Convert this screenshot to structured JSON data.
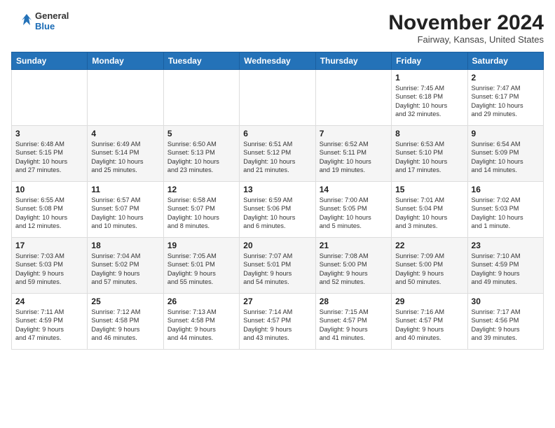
{
  "header": {
    "logo_line1": "General",
    "logo_line2": "Blue",
    "month": "November 2024",
    "location": "Fairway, Kansas, United States"
  },
  "days_of_week": [
    "Sunday",
    "Monday",
    "Tuesday",
    "Wednesday",
    "Thursday",
    "Friday",
    "Saturday"
  ],
  "weeks": [
    [
      {
        "day": "",
        "info": ""
      },
      {
        "day": "",
        "info": ""
      },
      {
        "day": "",
        "info": ""
      },
      {
        "day": "",
        "info": ""
      },
      {
        "day": "",
        "info": ""
      },
      {
        "day": "1",
        "info": "Sunrise: 7:45 AM\nSunset: 6:18 PM\nDaylight: 10 hours\nand 32 minutes."
      },
      {
        "day": "2",
        "info": "Sunrise: 7:47 AM\nSunset: 6:17 PM\nDaylight: 10 hours\nand 29 minutes."
      }
    ],
    [
      {
        "day": "3",
        "info": "Sunrise: 6:48 AM\nSunset: 5:15 PM\nDaylight: 10 hours\nand 27 minutes."
      },
      {
        "day": "4",
        "info": "Sunrise: 6:49 AM\nSunset: 5:14 PM\nDaylight: 10 hours\nand 25 minutes."
      },
      {
        "day": "5",
        "info": "Sunrise: 6:50 AM\nSunset: 5:13 PM\nDaylight: 10 hours\nand 23 minutes."
      },
      {
        "day": "6",
        "info": "Sunrise: 6:51 AM\nSunset: 5:12 PM\nDaylight: 10 hours\nand 21 minutes."
      },
      {
        "day": "7",
        "info": "Sunrise: 6:52 AM\nSunset: 5:11 PM\nDaylight: 10 hours\nand 19 minutes."
      },
      {
        "day": "8",
        "info": "Sunrise: 6:53 AM\nSunset: 5:10 PM\nDaylight: 10 hours\nand 17 minutes."
      },
      {
        "day": "9",
        "info": "Sunrise: 6:54 AM\nSunset: 5:09 PM\nDaylight: 10 hours\nand 14 minutes."
      }
    ],
    [
      {
        "day": "10",
        "info": "Sunrise: 6:55 AM\nSunset: 5:08 PM\nDaylight: 10 hours\nand 12 minutes."
      },
      {
        "day": "11",
        "info": "Sunrise: 6:57 AM\nSunset: 5:07 PM\nDaylight: 10 hours\nand 10 minutes."
      },
      {
        "day": "12",
        "info": "Sunrise: 6:58 AM\nSunset: 5:07 PM\nDaylight: 10 hours\nand 8 minutes."
      },
      {
        "day": "13",
        "info": "Sunrise: 6:59 AM\nSunset: 5:06 PM\nDaylight: 10 hours\nand 6 minutes."
      },
      {
        "day": "14",
        "info": "Sunrise: 7:00 AM\nSunset: 5:05 PM\nDaylight: 10 hours\nand 5 minutes."
      },
      {
        "day": "15",
        "info": "Sunrise: 7:01 AM\nSunset: 5:04 PM\nDaylight: 10 hours\nand 3 minutes."
      },
      {
        "day": "16",
        "info": "Sunrise: 7:02 AM\nSunset: 5:03 PM\nDaylight: 10 hours\nand 1 minute."
      }
    ],
    [
      {
        "day": "17",
        "info": "Sunrise: 7:03 AM\nSunset: 5:03 PM\nDaylight: 9 hours\nand 59 minutes."
      },
      {
        "day": "18",
        "info": "Sunrise: 7:04 AM\nSunset: 5:02 PM\nDaylight: 9 hours\nand 57 minutes."
      },
      {
        "day": "19",
        "info": "Sunrise: 7:05 AM\nSunset: 5:01 PM\nDaylight: 9 hours\nand 55 minutes."
      },
      {
        "day": "20",
        "info": "Sunrise: 7:07 AM\nSunset: 5:01 PM\nDaylight: 9 hours\nand 54 minutes."
      },
      {
        "day": "21",
        "info": "Sunrise: 7:08 AM\nSunset: 5:00 PM\nDaylight: 9 hours\nand 52 minutes."
      },
      {
        "day": "22",
        "info": "Sunrise: 7:09 AM\nSunset: 5:00 PM\nDaylight: 9 hours\nand 50 minutes."
      },
      {
        "day": "23",
        "info": "Sunrise: 7:10 AM\nSunset: 4:59 PM\nDaylight: 9 hours\nand 49 minutes."
      }
    ],
    [
      {
        "day": "24",
        "info": "Sunrise: 7:11 AM\nSunset: 4:59 PM\nDaylight: 9 hours\nand 47 minutes."
      },
      {
        "day": "25",
        "info": "Sunrise: 7:12 AM\nSunset: 4:58 PM\nDaylight: 9 hours\nand 46 minutes."
      },
      {
        "day": "26",
        "info": "Sunrise: 7:13 AM\nSunset: 4:58 PM\nDaylight: 9 hours\nand 44 minutes."
      },
      {
        "day": "27",
        "info": "Sunrise: 7:14 AM\nSunset: 4:57 PM\nDaylight: 9 hours\nand 43 minutes."
      },
      {
        "day": "28",
        "info": "Sunrise: 7:15 AM\nSunset: 4:57 PM\nDaylight: 9 hours\nand 41 minutes."
      },
      {
        "day": "29",
        "info": "Sunrise: 7:16 AM\nSunset: 4:57 PM\nDaylight: 9 hours\nand 40 minutes."
      },
      {
        "day": "30",
        "info": "Sunrise: 7:17 AM\nSunset: 4:56 PM\nDaylight: 9 hours\nand 39 minutes."
      }
    ]
  ]
}
